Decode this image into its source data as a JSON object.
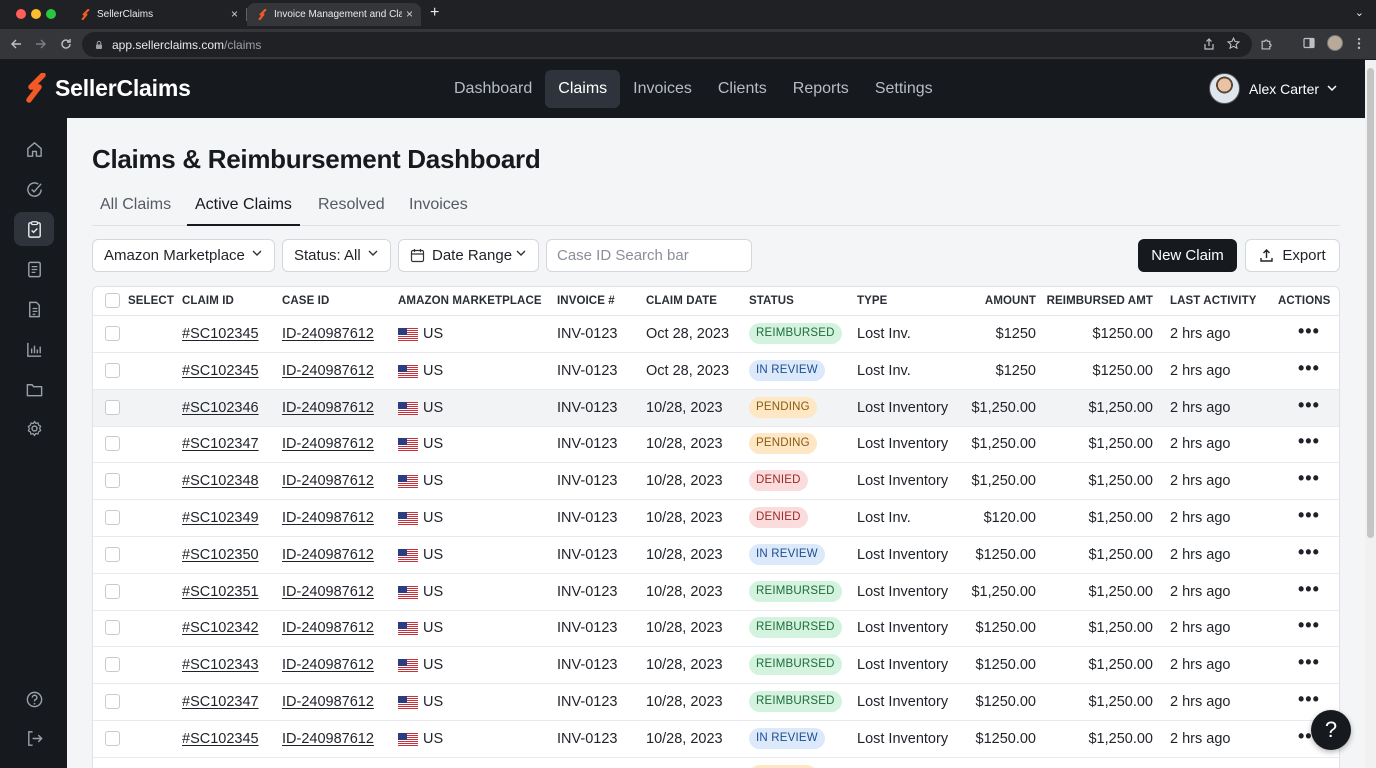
{
  "browser": {
    "tabs": [
      {
        "title": "SellerClaims",
        "close": "×"
      },
      {
        "title": "Invoice Management and Claims",
        "close": "×"
      }
    ],
    "new_tab": "+",
    "tab_menu": "⌄",
    "url_host": "app.sellerclaims.com",
    "url_path": "/claims"
  },
  "app": {
    "brand": "SellerClaims",
    "brand_color": "#f15a24",
    "nav": [
      "Dashboard",
      "Claims",
      "Invoices",
      "Clients",
      "Reports",
      "Settings"
    ],
    "active_nav": "Claims",
    "user_name": "Alex Carter"
  },
  "page": {
    "title": "Claims & Reimbursement Dashboard",
    "tabs": [
      "All Claims",
      "Active Claims",
      "Resolved",
      "Invoices"
    ],
    "active_tab": "Active Claims"
  },
  "filters": {
    "marketplace": "Amazon Marketplace",
    "status": "Status: All",
    "date_range": "Date Range",
    "search_placeholder": "Case ID Search bar",
    "new_claim": "New Claim",
    "export": "Export"
  },
  "table": {
    "headers": {
      "select": "SELECT",
      "claim_id": "CLAIM ID",
      "case_id": "CASE ID",
      "marketplace": "AMAZON MARKETPLACE",
      "invoice": "INVOICE #",
      "claim_date": "CLAIM DATE",
      "status": "STATUS",
      "type": "TYPE",
      "amount": "AMOUNT",
      "reimbursed": "REIMBURSED AMT",
      "last_activity": "LAST ACTIVITY",
      "actions": "ACTIONS"
    },
    "status_colors": {
      "REIMBURSED": {
        "bg": "#d3f3df",
        "fg": "#1e6b3c"
      },
      "IN REVIEW": {
        "bg": "#dbe9fb",
        "fg": "#1d4f91"
      },
      "PENDING": {
        "bg": "#fde7c4",
        "fg": "#8a5a10"
      },
      "DENIED": {
        "bg": "#fbdcdc",
        "fg": "#9b2a2a"
      }
    },
    "rows": [
      {
        "claim": "#SC102345",
        "case": "ID-240987612",
        "market": "US",
        "invoice": "INV-0123",
        "date": "Oct 28, 2023",
        "status": "REIMBURSED",
        "type": "Lost Inv.",
        "amount": "$1250",
        "reimbursed": "$1250.00",
        "activity": "2 hrs ago",
        "actions": "•••"
      },
      {
        "claim": "#SC102345",
        "case": "ID-240987612",
        "market": "US",
        "invoice": "INV-0123",
        "date": "Oct 28, 2023",
        "status": "IN REVIEW",
        "type": "Lost Inv.",
        "amount": "$1250",
        "reimbursed": "$1250.00",
        "activity": "2 hrs ago",
        "actions": "•••"
      },
      {
        "claim": "#SC102346",
        "case": "ID-240987612",
        "market": "US",
        "invoice": "INV-0123",
        "date": "10/28, 2023",
        "status": "PENDING",
        "type": "Lost Inventory",
        "amount": "$1,250.00",
        "reimbursed": "$1,250.00",
        "activity": "2 hrs ago",
        "actions": "•••"
      },
      {
        "claim": "#SC102347",
        "case": "ID-240987612",
        "market": "US",
        "invoice": "INV-0123",
        "date": "10/28, 2023",
        "status": "PENDING",
        "type": "Lost Inventory",
        "amount": "$1,250.00",
        "reimbursed": "$1,250.00",
        "activity": "2 hrs ago",
        "actions": "•••"
      },
      {
        "claim": "#SC102348",
        "case": "ID-240987612",
        "market": "US",
        "invoice": "INV-0123",
        "date": "10/28, 2023",
        "status": "DENIED",
        "type": "Lost Inventory",
        "amount": "$1,250.00",
        "reimbursed": "$1,250.00",
        "activity": "2 hrs ago",
        "actions": "•••"
      },
      {
        "claim": "#SC102349",
        "case": "ID-240987612",
        "market": "US",
        "invoice": "INV-0123",
        "date": "10/28, 2023",
        "status": "DENIED",
        "type": "Lost Inv.",
        "amount": "$120.00",
        "reimbursed": "$1,250.00",
        "activity": "2 hrs ago",
        "actions": "•••"
      },
      {
        "claim": "#SC102350",
        "case": "ID-240987612",
        "market": "US",
        "invoice": "INV-0123",
        "date": "10/28, 2023",
        "status": "IN REVIEW",
        "type": "Lost Inventory",
        "amount": "$1250.00",
        "reimbursed": "$1,250.00",
        "activity": "2 hrs ago",
        "actions": "•••"
      },
      {
        "claim": "#SC102351",
        "case": "ID-240987612",
        "market": "US",
        "invoice": "INV-0123",
        "date": "10/28, 2023",
        "status": "REIMBURSED",
        "type": "Lost Inventory",
        "amount": "$1,250.00",
        "reimbursed": "$1,250.00",
        "activity": "2 hrs ago",
        "actions": "•••"
      },
      {
        "claim": "#SC102342",
        "case": "ID-240987612",
        "market": "US",
        "invoice": "INV-0123",
        "date": "10/28, 2023",
        "status": "REIMBURSED",
        "type": "Lost Inventory",
        "amount": "$1250.00",
        "reimbursed": "$1,250.00",
        "activity": "2 hrs ago",
        "actions": "•••"
      },
      {
        "claim": "#SC102343",
        "case": "ID-240987612",
        "market": "US",
        "invoice": "INV-0123",
        "date": "10/28, 2023",
        "status": "REIMBURSED",
        "type": "Lost Inventory",
        "amount": "$1250.00",
        "reimbursed": "$1,250.00",
        "activity": "2 hrs ago",
        "actions": "•••"
      },
      {
        "claim": "#SC102347",
        "case": "ID-240987612",
        "market": "US",
        "invoice": "INV-0123",
        "date": "10/28, 2023",
        "status": "REIMBURSED",
        "type": "Lost Inventory",
        "amount": "$1250.00",
        "reimbursed": "$1,250.00",
        "activity": "2 hrs ago",
        "actions": "•••"
      },
      {
        "claim": "#SC102345",
        "case": "ID-240987612",
        "market": "US",
        "invoice": "INV-0123",
        "date": "10/28, 2023",
        "status": "IN REVIEW",
        "type": "Lost Inventory",
        "amount": "$1250.00",
        "reimbursed": "$1,250.00",
        "activity": "2 hrs ago",
        "actions": "•••"
      },
      {
        "claim": "",
        "case": "",
        "market": "",
        "invoice": "",
        "date": "",
        "status": "PENDING",
        "type": "",
        "amount": "",
        "reimbursed": "",
        "activity": "",
        "actions": ""
      }
    ]
  },
  "help_label": "?",
  "icons": {
    "sidebar": [
      "home-icon",
      "activity-icon",
      "claims-icon",
      "invoices-icon",
      "document-icon",
      "reports-icon",
      "folder-icon",
      "settings-icon",
      "help-icon",
      "logout-icon"
    ]
  }
}
